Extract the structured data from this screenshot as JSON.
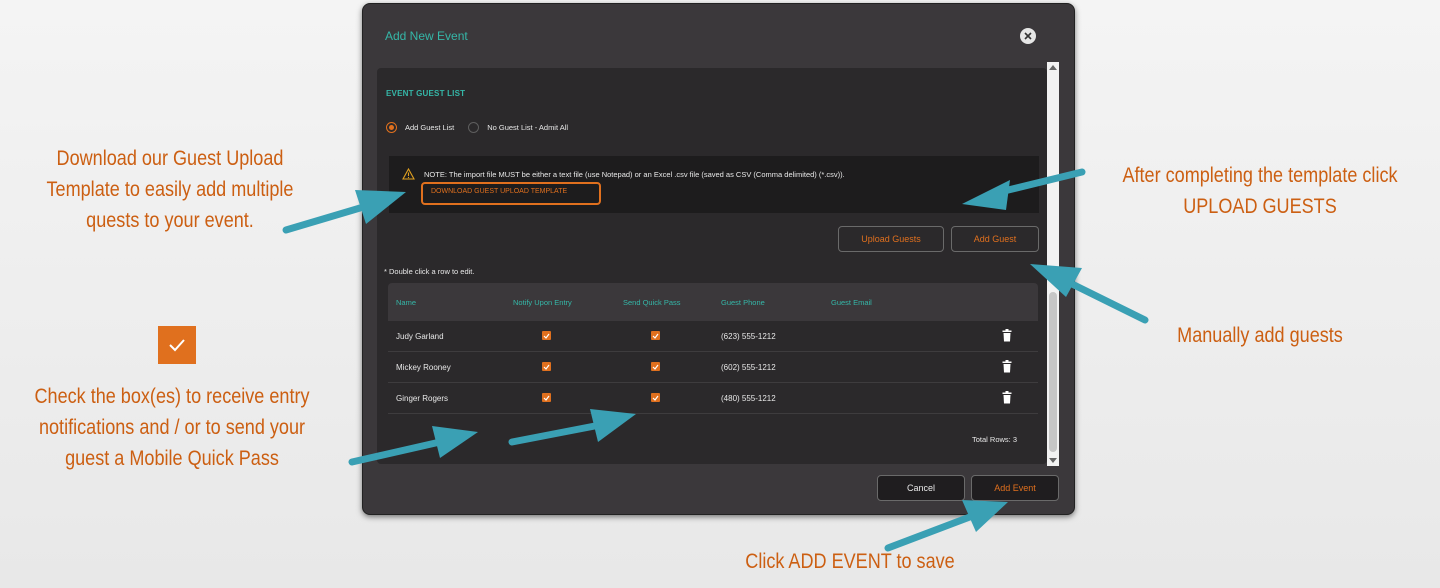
{
  "annotations": {
    "download_template": [
      "Download our Guest Upload",
      "Template to easily add multiple",
      "quests to your event."
    ],
    "checkboxes": [
      "Check the box(es) to receive entry",
      "notifications and / or to send your",
      "guest a Mobile Quick Pass"
    ],
    "upload_guests": [
      "After completing the template click",
      "UPLOAD GUESTS"
    ],
    "manual_add": [
      "Manually add guests"
    ],
    "add_event": [
      "Click ADD EVENT to save"
    ]
  },
  "modal": {
    "title": "Add New Event",
    "section_title": "EVENT GUEST LIST",
    "radio_add": "Add Guest List",
    "radio_none": "No Guest List - Admit All",
    "note": "NOTE: The import file MUST be either a text file (use Notepad) or an Excel .csv file (saved as CSV (Comma delimited) (*.csv)).",
    "download_link": "DOWNLOAD GUEST UPLOAD TEMPLATE",
    "upload_button": "Upload Guests",
    "add_guest_button": "Add Guest",
    "hint": "* Double click a row to edit.",
    "columns": [
      "Name",
      "Notify Upon Entry",
      "Send Quick Pass",
      "Guest Phone",
      "Guest Email"
    ],
    "guests": [
      {
        "name": "Judy Garland",
        "phone": "(623) 555-1212",
        "email": ""
      },
      {
        "name": "Mickey Rooney",
        "phone": "(602) 555-1212",
        "email": ""
      },
      {
        "name": "Ginger Rogers",
        "phone": "(480) 555-1212",
        "email": ""
      }
    ],
    "total_rows": "Total Rows: 3",
    "cancel_button": "Cancel",
    "add_event_button": "Add Event"
  },
  "colors": {
    "accent": "#e0701e",
    "teal": "#35b7a8",
    "annotation": "#cc5f12",
    "arrow": "#3aa0b4"
  },
  "icons": [
    "close-icon",
    "warning-icon",
    "trash-icon",
    "checkmark-icon",
    "arrow-icon"
  ]
}
